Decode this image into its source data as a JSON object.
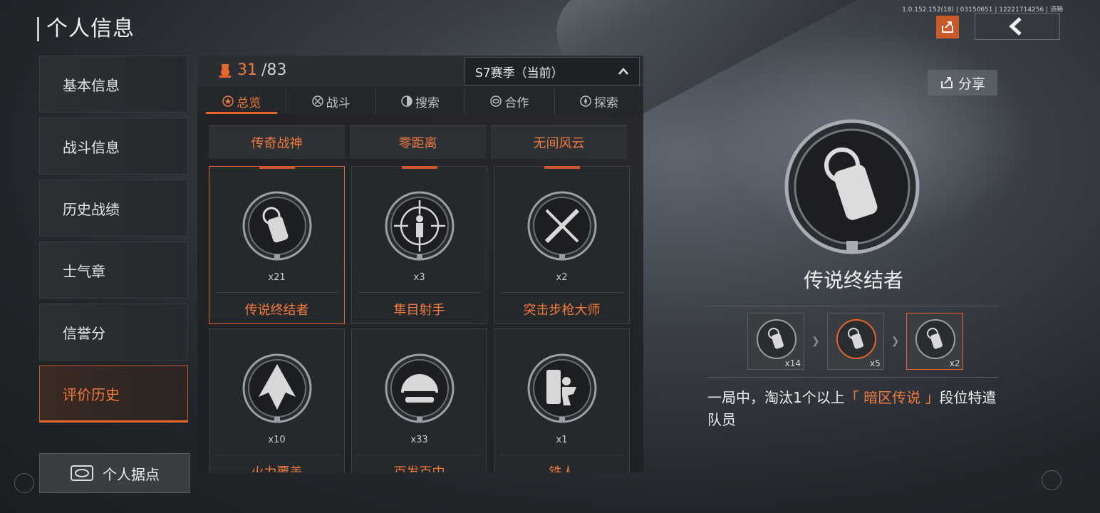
{
  "header": {
    "title": "个人信息",
    "version": "1.0.152.152(18) | 03150651 | 12221714256 | 流畅",
    "share_label": "分享"
  },
  "sidebar": {
    "items": [
      {
        "label": "基本信息",
        "active": false
      },
      {
        "label": "战斗信息",
        "active": false
      },
      {
        "label": "历史战绩",
        "active": false
      },
      {
        "label": "士气章",
        "active": false
      },
      {
        "label": "信誉分",
        "active": false
      },
      {
        "label": "评价历史",
        "active": true
      }
    ],
    "home_label": "个人据点"
  },
  "panel": {
    "count_current": "31",
    "count_total": "/83",
    "season": "S7赛季（当前）",
    "tabs": [
      {
        "label": "总览",
        "icon": "star-icon",
        "active": true
      },
      {
        "label": "战斗",
        "icon": "crosshair-icon",
        "active": false
      },
      {
        "label": "搜索",
        "icon": "search-icon",
        "active": false
      },
      {
        "label": "合作",
        "icon": "handshake-icon",
        "active": false
      },
      {
        "label": "探索",
        "icon": "compass-icon",
        "active": false
      }
    ],
    "column_headers": [
      "传奇战神",
      "零距离",
      "无间风云"
    ],
    "cards": [
      {
        "name": "传说终结者",
        "count": "x21",
        "icon": "dog-tag-icon",
        "selected": true
      },
      {
        "name": "隼目射手",
        "count": "x3",
        "icon": "sniper-scope-icon",
        "selected": false
      },
      {
        "name": "突击步枪大师",
        "count": "x2",
        "icon": "assault-rifle-icon",
        "selected": false
      },
      {
        "name": "火力覆盖",
        "count": "x10",
        "icon": "arrowhead-icon",
        "selected": false
      },
      {
        "name": "百发百中",
        "count": "x33",
        "icon": "helmet-icon",
        "selected": false
      },
      {
        "name": "铁人",
        "count": "x1",
        "icon": "shield-soldier-icon",
        "selected": false
      }
    ]
  },
  "detail": {
    "name": "传说终结者",
    "tiers": [
      {
        "count": "x14",
        "current": false
      },
      {
        "count": "x5",
        "current": false
      },
      {
        "count": "x2",
        "current": true
      }
    ],
    "desc_before": "一局中，淘汰1个以上",
    "desc_highlight": "「 暗区传说 」",
    "desc_after": "段位特遣队员"
  },
  "colors": {
    "accent": "#e8652c",
    "accent_text": "#f07a3e",
    "panel_bg": "#26292c"
  }
}
